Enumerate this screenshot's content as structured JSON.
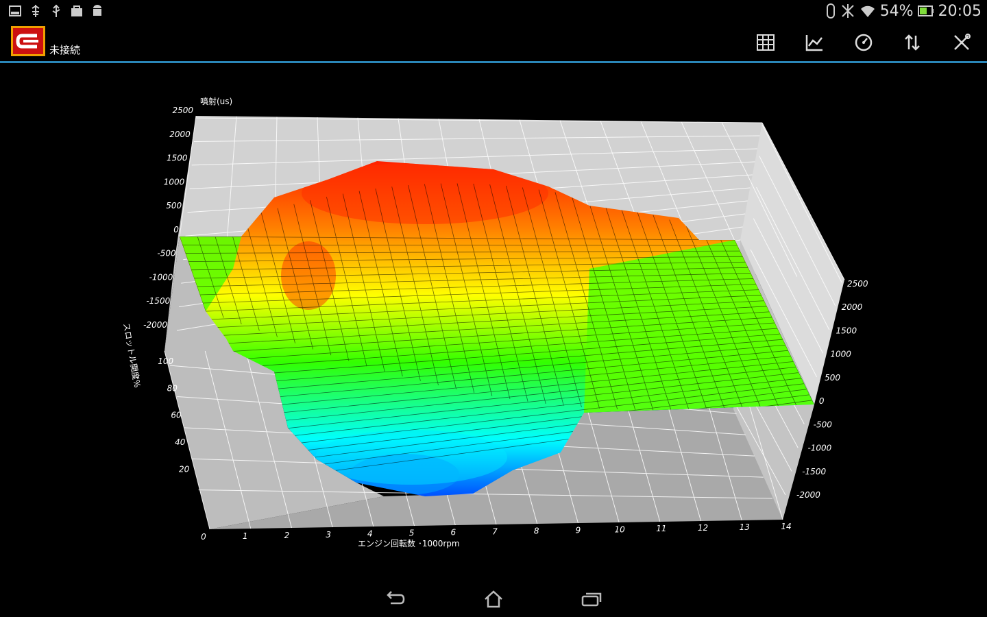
{
  "status_bar": {
    "left_icons": [
      "screenshot-icon",
      "usb-debug-icon",
      "usb-icon",
      "bag-icon",
      "android-icon"
    ],
    "right_icons": [
      "bluetooth-icon",
      "mute-icon",
      "wifi-icon",
      "battery-icon"
    ],
    "battery": "54%",
    "time": "20:05"
  },
  "action_bar": {
    "app_logo": "app-logo",
    "connection_status": "未接続",
    "actions": [
      {
        "name": "table-view",
        "icon": "grid-icon"
      },
      {
        "name": "graph-view",
        "icon": "line-chart-icon"
      },
      {
        "name": "gauge-view",
        "icon": "gauge-icon"
      },
      {
        "name": "transfer",
        "icon": "sort-updown-icon"
      },
      {
        "name": "settings",
        "icon": "tools-icon"
      }
    ],
    "accent_color": "#2a86b8"
  },
  "chart_data": {
    "type": "surface3d",
    "title": "",
    "zlabel": "噴射(us)",
    "ylabel": "スロットル開度%",
    "xlabel": "エンジン回転数 ･1000rpm",
    "x_ticks": [
      "0",
      "1",
      "2",
      "3",
      "4",
      "5",
      "6",
      "7",
      "8",
      "9",
      "10",
      "11",
      "12",
      "13",
      "14"
    ],
    "y_ticks": [
      "20",
      "40",
      "60",
      "80",
      "100"
    ],
    "z_ticks_left": [
      "2500",
      "2000",
      "1500",
      "1000",
      "500",
      "0",
      "-500",
      "-1000",
      "-1500",
      "-2000"
    ],
    "z_ticks_right": [
      "2500",
      "2000",
      "1500",
      "1000",
      "500",
      "0",
      "-500",
      "-1000",
      "-1500",
      "-2000"
    ],
    "xlim": [
      0,
      14
    ],
    "ylim": [
      0,
      100
    ],
    "zlim": [
      -2500,
      2500
    ],
    "colormap": [
      "#0050ff",
      "#00ffff",
      "#33ff00",
      "#ffff00",
      "#ff8000",
      "#ff2000"
    ],
    "grid": true
  },
  "nav_bar": {
    "buttons": [
      {
        "name": "back",
        "icon": "back-icon"
      },
      {
        "name": "home",
        "icon": "home-icon"
      },
      {
        "name": "recents",
        "icon": "recents-icon"
      }
    ]
  }
}
